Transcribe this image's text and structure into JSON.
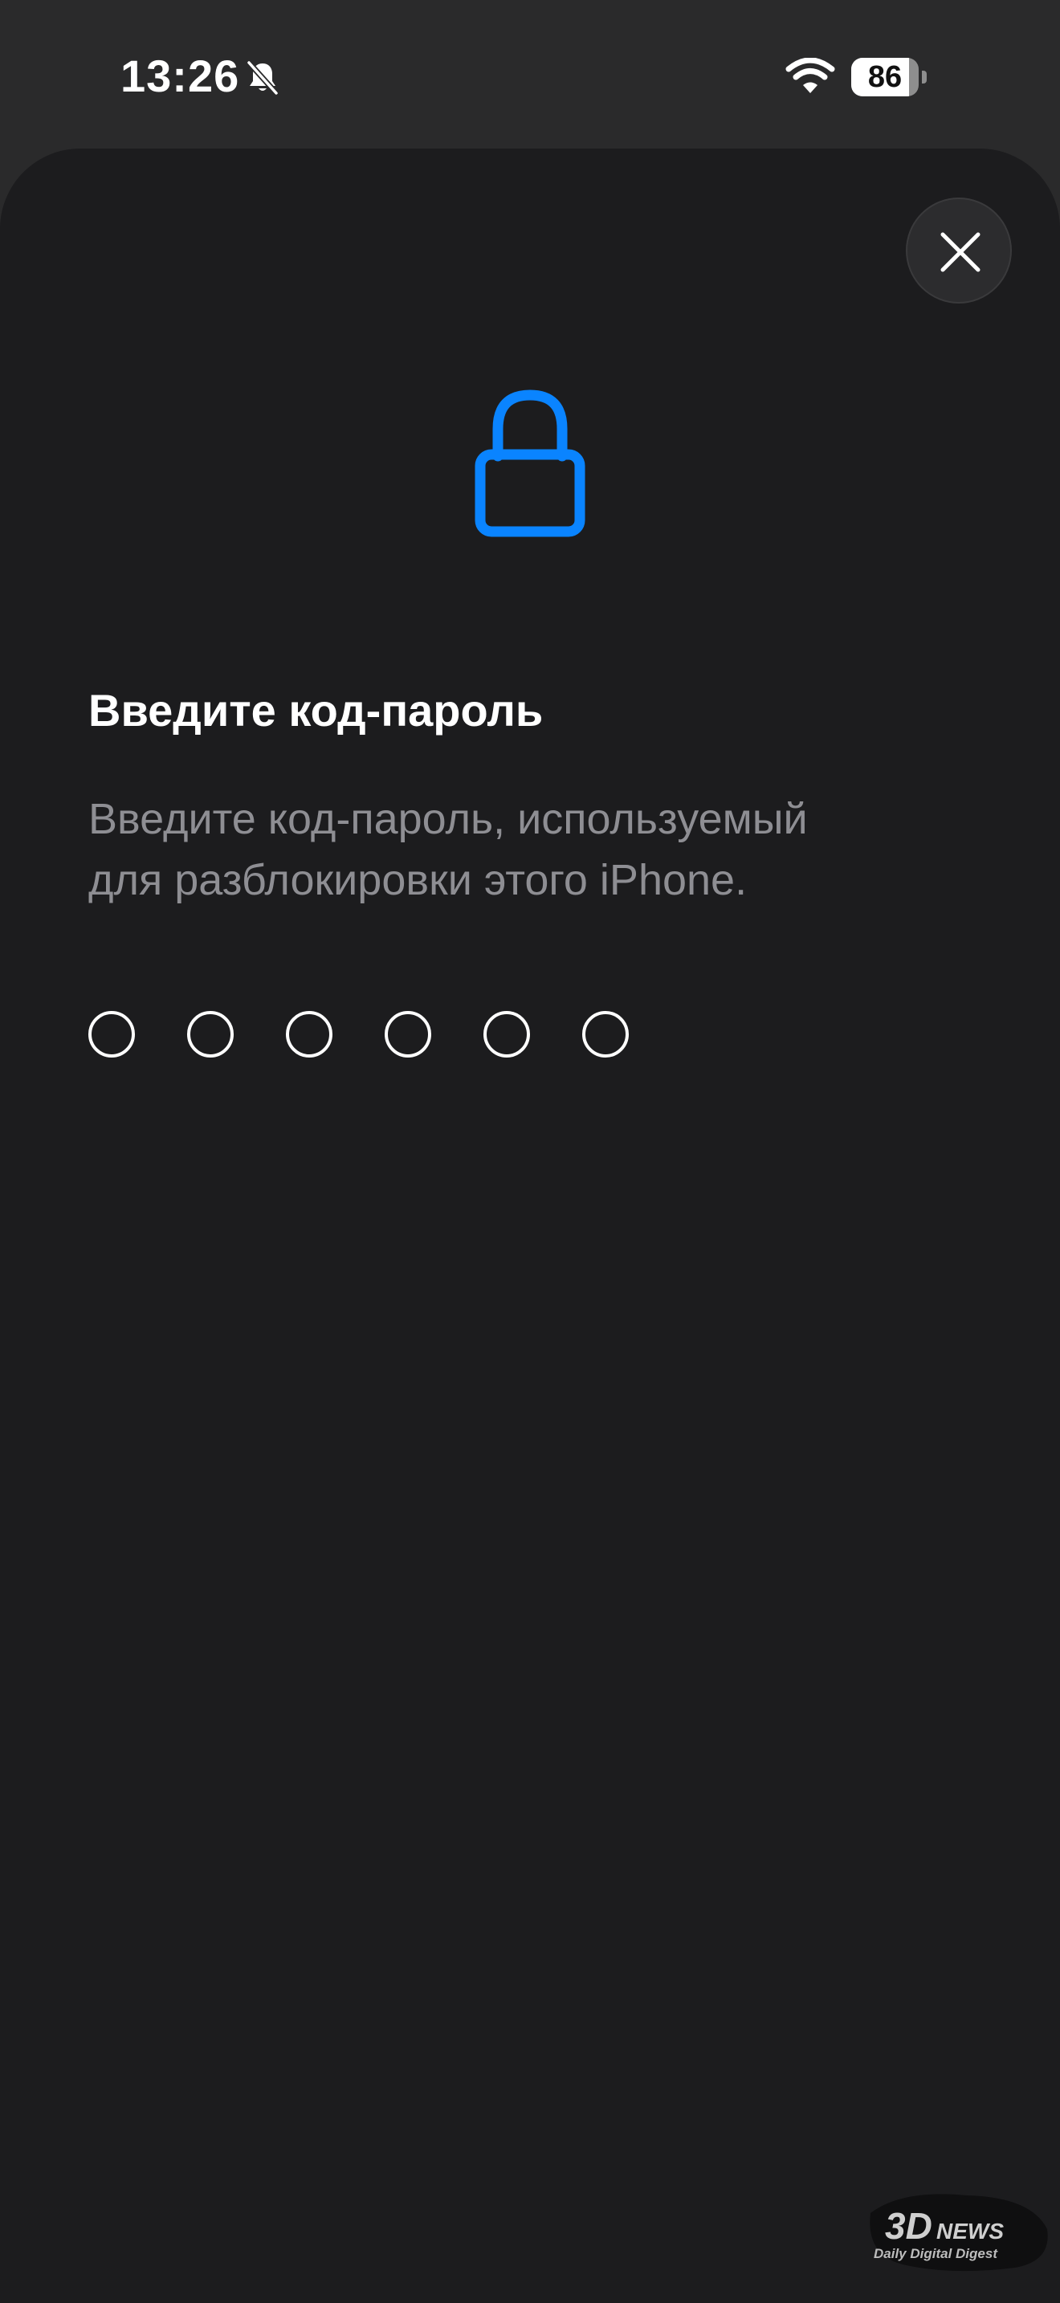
{
  "status_bar": {
    "time": "13:26",
    "battery_level": "86",
    "battery_fraction": 0.86,
    "icons": [
      "bell-slash-icon",
      "wifi-icon",
      "battery-icon"
    ]
  },
  "sheet": {
    "close_icon": "close-icon",
    "lock_icon": "lock-icon",
    "accent_color": "#0a84ff",
    "title": "Введите код-пароль",
    "subtitle_lines": [
      "Введите код-пароль, используемый",
      "для разблокировки этого iPhone."
    ],
    "passcode_length": 6
  },
  "watermark": {
    "brand": "3DNEWS",
    "tagline": "Daily Digital Digest"
  }
}
